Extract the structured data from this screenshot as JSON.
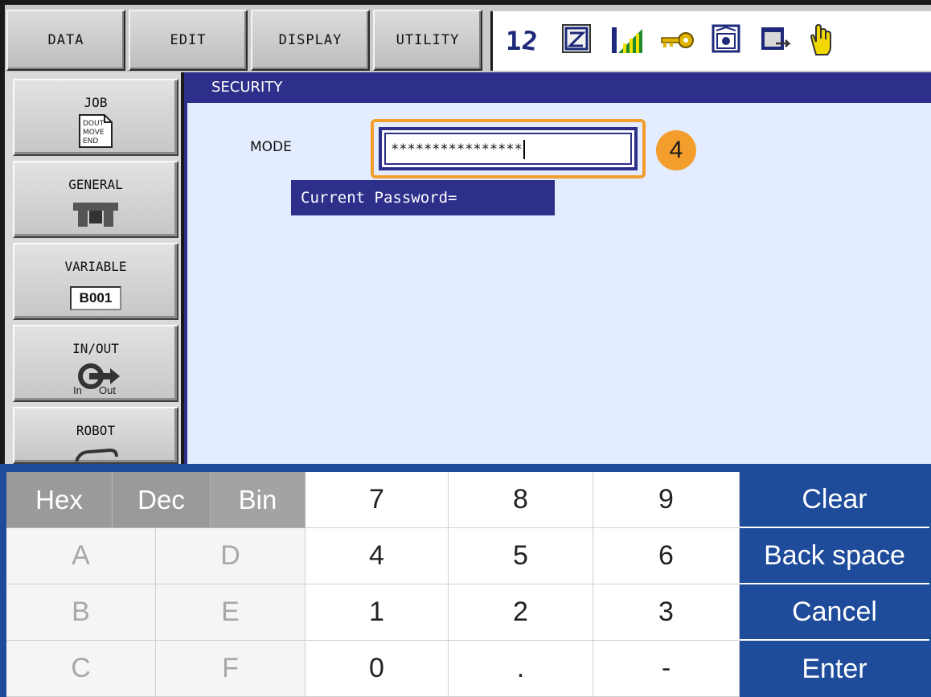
{
  "menu": {
    "tabs": [
      "DATA",
      "EDIT",
      "DISPLAY",
      "UTILITY"
    ]
  },
  "toolbar": {
    "icons": [
      "page-numbers-icon",
      "edit-z-icon",
      "signal-bars-icon",
      "key-icon",
      "teach-mode-icon",
      "window-arrow-icon",
      "hand-servo-icon"
    ]
  },
  "sidebar": {
    "items": [
      {
        "label": "JOB",
        "icon_text": [
          "DOUT",
          "MOVE",
          "END"
        ]
      },
      {
        "label": "GENERAL",
        "icon": "tool-icon"
      },
      {
        "label": "VARIABLE",
        "icon_text": [
          "B001"
        ]
      },
      {
        "label": "IN/OUT",
        "icon_text": [
          "In",
          "Out"
        ]
      },
      {
        "label": "ROBOT",
        "icon": "robot-arm-icon"
      }
    ]
  },
  "main": {
    "title": "SECURITY",
    "mode_label": "MODE",
    "password_value": "****************",
    "prompt": "Current Password=",
    "step_number": "4"
  },
  "keypad": {
    "modes": [
      "Hex",
      "Dec",
      "Bin"
    ],
    "hex_keys": [
      [
        "A",
        "D"
      ],
      [
        "B",
        "E"
      ],
      [
        "C",
        "F"
      ]
    ],
    "digits": [
      [
        "7",
        "8",
        "9"
      ],
      [
        "4",
        "5",
        "6"
      ],
      [
        "1",
        "2",
        "3"
      ],
      [
        "0",
        ".",
        "-"
      ]
    ],
    "actions": [
      "Clear",
      "Back space",
      "Cancel",
      "Enter"
    ]
  },
  "colors": {
    "accent": "#2d2f8a",
    "highlight": "#f29d2c",
    "keypad_blue": "#1e4b9a",
    "content_bg": "#e3edff"
  }
}
